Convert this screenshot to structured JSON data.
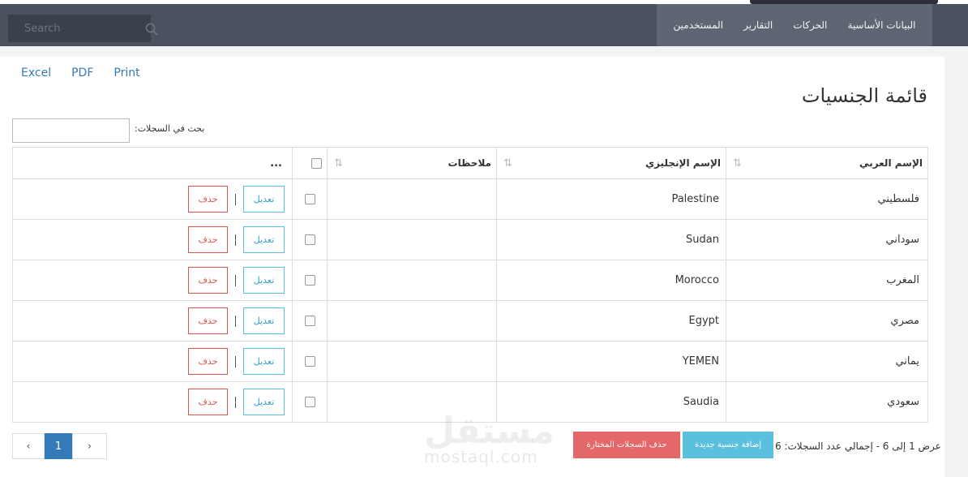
{
  "header": {
    "search_placeholder": "Search",
    "menu": [
      "البيانات الأساسية",
      "الحركات",
      "التقارير",
      "المستخدمين"
    ],
    "icon_search": "search-icon"
  },
  "toolbar": {
    "excel": "Excel",
    "pdf": "PDF",
    "print": "Print"
  },
  "page": {
    "title": "قائمة الجنسيات",
    "filter_label": "بحث في السجلات:"
  },
  "table": {
    "headers": {
      "arabic_name": "الإسم العربي",
      "english_name": "الإسم الإنجليزي",
      "notes": "ملاحظات",
      "actions": "..."
    },
    "rows": [
      {
        "ar": "فلسطيني",
        "en": "Palestine",
        "notes": ""
      },
      {
        "ar": "سوداني",
        "en": "Sudan",
        "notes": ""
      },
      {
        "ar": "المغرب",
        "en": "Morocco",
        "notes": ""
      },
      {
        "ar": "مصري",
        "en": "Egypt",
        "notes": ""
      },
      {
        "ar": "يماني",
        "en": "YEMEN",
        "notes": ""
      },
      {
        "ar": "سعودي",
        "en": "Saudia",
        "notes": ""
      }
    ],
    "edit_label": "تعديل",
    "delete_label": "حذف"
  },
  "footer": {
    "summary": "عرض 1 إلى 6 - إجمالي عدد السجلات: 6",
    "add_label": "إضافة جنسية جديدة",
    "bulk_delete_label": "حذف السجلات المختارة",
    "pager": {
      "prev": "‹",
      "current": "1",
      "next": "›"
    }
  },
  "watermark": {
    "arabic": "مستقل",
    "latin": "mostaql.com"
  },
  "colors": {
    "navbar": "#4a5260",
    "menu": "#5e6673",
    "primary": "#337ab7",
    "info": "#5bc0de",
    "danger": "#d9534f"
  }
}
